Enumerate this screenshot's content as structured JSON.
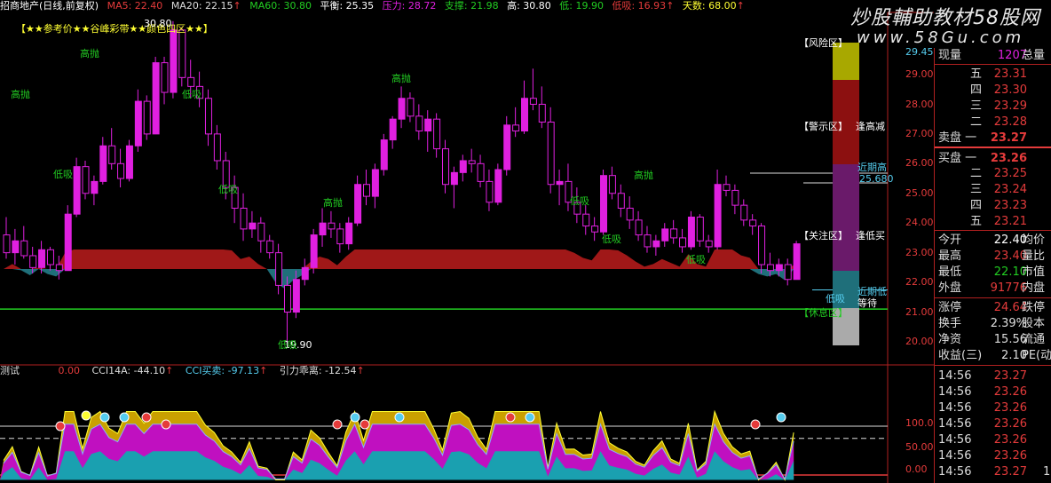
{
  "header": {
    "name": "招商地产(日线,前复权)",
    "ma5": "MA5: 22.40",
    "ma20": "MA20: 22.15",
    "ma20_arrow": "↑",
    "ma60": "MA60: 30.80",
    "balance": "平衡: 25.35",
    "pressure": "压力: 28.72",
    "support": "支撑: 21.98",
    "high": "高: 30.80",
    "low": "低: 19.90",
    "low_absorb": "低吸: 16.93",
    "low_absorb_arrow": "↑",
    "days": "天数: 68.00",
    "days_arrow": "↑"
  },
  "legend_banner": "【★★参考价★★谷峰彩带★★颜色四区★★】",
  "watermark": {
    "line1": "炒股輔助教材58股网",
    "line2": "www.58Gu.com"
  },
  "zones": {
    "risk": "【风险区】",
    "warning": "【警示区】",
    "watch": "【关注区】",
    "rest": "【休息区】",
    "high_reduce": "逢高减",
    "near_high": "近期高",
    "near_high_value": "25.680",
    "low_buy": "逢低买",
    "near_low": "近期低",
    "low_buy_2": "低吸",
    "rest_extra": "等待"
  },
  "chart_labels": {
    "high_sell": "高抛",
    "low_buy": "低吸",
    "top_value": "30.80",
    "bottom_value": "19.90"
  },
  "price_axis": [
    "29.00",
    "28.00",
    "27.00",
    "26.00",
    "25.00",
    "24.00",
    "23.00",
    "22.00",
    "21.00",
    "20.00"
  ],
  "price_axis_top": "29.45",
  "osc_axis": [
    "100.0",
    "50.00",
    "0.00"
  ],
  "sub_header": {
    "name": "测试",
    "zero": "0.00",
    "cci": "CCI14A: -44.10",
    "cci_arrow": "↑",
    "cci_buysell": "CCI买卖: -97.13",
    "cci_buysell_arrow": "↑",
    "gravity": "引力乖离: -12.54",
    "gravity_arrow": "↑"
  },
  "quote": {
    "volume_label": "现量",
    "volume_value": "1207",
    "total_label": "总量",
    "ask": [
      {
        "label": "五",
        "price": "23.31"
      },
      {
        "label": "四",
        "price": "23.30"
      },
      {
        "label": "三",
        "price": "23.29"
      },
      {
        "label": "二",
        "price": "23.28"
      },
      {
        "label": "卖盘 一",
        "price": "23.27"
      }
    ],
    "bid": [
      {
        "label": "买盘 一",
        "price": "23.26"
      },
      {
        "label": "二",
        "price": "23.25"
      },
      {
        "label": "三",
        "price": "23.24"
      },
      {
        "label": "四",
        "price": "23.23"
      },
      {
        "label": "五",
        "price": "23.21"
      }
    ],
    "stats": [
      {
        "label": "今开",
        "value": "22.40",
        "label2": "均价",
        "color": "#e53b3b"
      },
      {
        "label": "最高",
        "value": "23.40",
        "label2": "量比",
        "color": "#e53b3b"
      },
      {
        "label": "最低",
        "value": "22.10",
        "label2": "市值",
        "color": "#22cc22"
      },
      {
        "label": "外盘",
        "value": "91776",
        "label2": "内盘",
        "color": "#e53b3b"
      }
    ],
    "stats2": [
      {
        "label": "涨停",
        "value": "24.64",
        "label2": "跌停",
        "color": "#e53b3b"
      },
      {
        "label": "换手",
        "value": "2.39%",
        "label2": "股本",
        "color": "#dddddd"
      },
      {
        "label": "净资",
        "value": "15.56",
        "label2": "流通",
        "color": "#dddddd"
      },
      {
        "label": "收益(三)",
        "value": "2.10",
        "label2": "PE(动",
        "color": "#dddddd"
      }
    ],
    "ticks": [
      {
        "time": "14:56",
        "price": "23.27"
      },
      {
        "time": "14:56",
        "price": "23.26"
      },
      {
        "time": "14:56",
        "price": "23.26"
      },
      {
        "time": "14:56",
        "price": "23.26"
      },
      {
        "time": "14:56",
        "price": "23.26"
      },
      {
        "time": "14:56",
        "price": "23.26"
      },
      {
        "time": "14:56",
        "price": "23.27"
      }
    ],
    "tick_extra": "1"
  },
  "colors": {
    "up": "#e53b3b",
    "down": "#22cc22",
    "candle": "#e020e0",
    "yellow": "#ffff33",
    "cyan": "#22b0c0",
    "band_red": "#a01818",
    "band_teal": "#1f6f7a"
  },
  "chart_data": {
    "type": "candlestick",
    "ylim": [
      19.5,
      29.5
    ],
    "support_line": 21.1,
    "near_high_line": 25.68,
    "candles": [
      [
        23.6,
        24.2,
        22.8,
        23.0
      ],
      [
        23.0,
        23.8,
        22.6,
        23.4
      ],
      [
        23.4,
        23.9,
        22.8,
        22.9
      ],
      [
        22.9,
        23.2,
        22.3,
        22.5
      ],
      [
        22.5,
        23.4,
        22.3,
        23.1
      ],
      [
        23.1,
        23.2,
        22.4,
        22.6
      ],
      [
        22.6,
        22.9,
        22.1,
        22.4
      ],
      [
        22.4,
        24.6,
        22.4,
        24.3
      ],
      [
        24.3,
        26.2,
        24.2,
        25.9
      ],
      [
        25.9,
        26.1,
        24.8,
        25.0
      ],
      [
        25.0,
        25.6,
        24.6,
        25.4
      ],
      [
        25.4,
        26.9,
        25.3,
        26.6
      ],
      [
        26.6,
        27.2,
        25.8,
        26.0
      ],
      [
        26.0,
        26.5,
        25.2,
        25.5
      ],
      [
        25.5,
        26.8,
        25.4,
        26.6
      ],
      [
        26.6,
        28.5,
        26.4,
        28.1
      ],
      [
        28.1,
        28.3,
        26.8,
        27.0
      ],
      [
        27.0,
        29.6,
        27.0,
        29.4
      ],
      [
        29.4,
        29.6,
        28.0,
        28.4
      ],
      [
        28.4,
        30.8,
        28.2,
        30.5
      ],
      [
        30.5,
        30.6,
        28.6,
        28.9
      ],
      [
        28.9,
        29.5,
        28.2,
        28.6
      ],
      [
        28.6,
        29.1,
        27.9,
        28.2
      ],
      [
        28.2,
        28.5,
        26.6,
        27.0
      ],
      [
        27.0,
        27.3,
        25.8,
        26.1
      ],
      [
        26.1,
        26.4,
        24.8,
        25.2
      ],
      [
        25.2,
        25.6,
        24.0,
        24.5
      ],
      [
        24.5,
        25.0,
        23.4,
        23.8
      ],
      [
        23.8,
        24.4,
        23.5,
        24.0
      ],
      [
        24.0,
        24.2,
        23.0,
        23.4
      ],
      [
        23.4,
        23.6,
        22.8,
        23.0
      ],
      [
        23.0,
        23.3,
        21.6,
        21.9
      ],
      [
        21.9,
        22.2,
        19.9,
        21.0
      ],
      [
        21.0,
        22.4,
        20.8,
        22.1
      ],
      [
        22.1,
        22.8,
        21.9,
        22.5
      ],
      [
        22.5,
        23.8,
        22.3,
        23.6
      ],
      [
        23.6,
        24.5,
        23.2,
        24.0
      ],
      [
        24.0,
        24.4,
        23.5,
        23.8
      ],
      [
        23.8,
        24.0,
        23.0,
        23.3
      ],
      [
        23.3,
        24.2,
        23.1,
        24.0
      ],
      [
        24.0,
        25.6,
        23.9,
        25.3
      ],
      [
        25.3,
        25.8,
        24.6,
        24.9
      ],
      [
        24.9,
        26.0,
        24.5,
        25.8
      ],
      [
        25.8,
        27.0,
        25.6,
        26.8
      ],
      [
        26.8,
        27.6,
        26.5,
        27.5
      ],
      [
        27.5,
        28.6,
        27.2,
        28.2
      ],
      [
        28.2,
        28.4,
        27.4,
        27.6
      ],
      [
        27.6,
        28.0,
        26.8,
        27.1
      ],
      [
        27.1,
        27.8,
        26.4,
        27.5
      ],
      [
        27.5,
        27.7,
        26.2,
        26.5
      ],
      [
        26.5,
        26.8,
        25.0,
        25.3
      ],
      [
        25.3,
        25.9,
        24.5,
        25.7
      ],
      [
        25.7,
        26.3,
        25.4,
        26.1
      ],
      [
        26.1,
        26.5,
        25.7,
        26.0
      ],
      [
        26.0,
        26.3,
        25.2,
        25.4
      ],
      [
        25.4,
        25.8,
        24.4,
        24.7
      ],
      [
        24.7,
        26.0,
        24.6,
        25.8
      ],
      [
        25.8,
        27.6,
        25.6,
        27.3
      ],
      [
        27.3,
        27.9,
        26.9,
        27.1
      ],
      [
        27.1,
        28.8,
        27.0,
        28.2
      ],
      [
        28.2,
        29.2,
        27.8,
        28.0
      ],
      [
        28.0,
        28.6,
        27.2,
        27.4
      ],
      [
        27.4,
        27.9,
        25.0,
        25.3
      ],
      [
        25.3,
        25.8,
        24.6,
        25.4
      ],
      [
        25.4,
        26.0,
        24.4,
        24.7
      ],
      [
        24.7,
        25.2,
        24.0,
        24.3
      ],
      [
        24.3,
        24.6,
        23.6,
        23.9
      ],
      [
        23.9,
        24.2,
        23.4,
        23.7
      ],
      [
        23.7,
        25.8,
        23.6,
        25.6
      ],
      [
        25.6,
        25.9,
        24.8,
        25.0
      ],
      [
        25.0,
        25.3,
        24.2,
        24.5
      ],
      [
        24.5,
        24.9,
        23.8,
        24.1
      ],
      [
        24.1,
        24.4,
        23.4,
        23.6
      ],
      [
        23.6,
        23.9,
        23.0,
        23.2
      ],
      [
        23.2,
        23.6,
        22.9,
        23.4
      ],
      [
        23.4,
        24.0,
        23.2,
        23.8
      ],
      [
        23.8,
        24.1,
        23.3,
        23.5
      ],
      [
        23.5,
        23.8,
        23.0,
        23.2
      ],
      [
        23.2,
        24.4,
        23.1,
        24.2
      ],
      [
        24.2,
        24.3,
        23.2,
        23.4
      ],
      [
        23.4,
        23.6,
        23.0,
        23.2
      ],
      [
        23.2,
        25.8,
        23.1,
        25.3
      ],
      [
        25.3,
        25.6,
        24.9,
        25.1
      ],
      [
        25.1,
        25.3,
        24.3,
        24.6
      ],
      [
        24.6,
        24.8,
        23.9,
        24.1
      ],
      [
        24.1,
        24.3,
        23.6,
        23.9
      ],
      [
        23.9,
        24.0,
        22.3,
        22.6
      ],
      [
        22.6,
        23.0,
        22.2,
        22.4
      ],
      [
        22.4,
        22.8,
        22.2,
        22.6
      ],
      [
        22.6,
        22.8,
        21.9,
        22.1
      ],
      [
        22.1,
        23.4,
        22.1,
        23.3
      ]
    ],
    "oscillator": {
      "type": "area",
      "ylim": [
        -10,
        130
      ],
      "levels": [
        100,
        75,
        0
      ]
    }
  }
}
